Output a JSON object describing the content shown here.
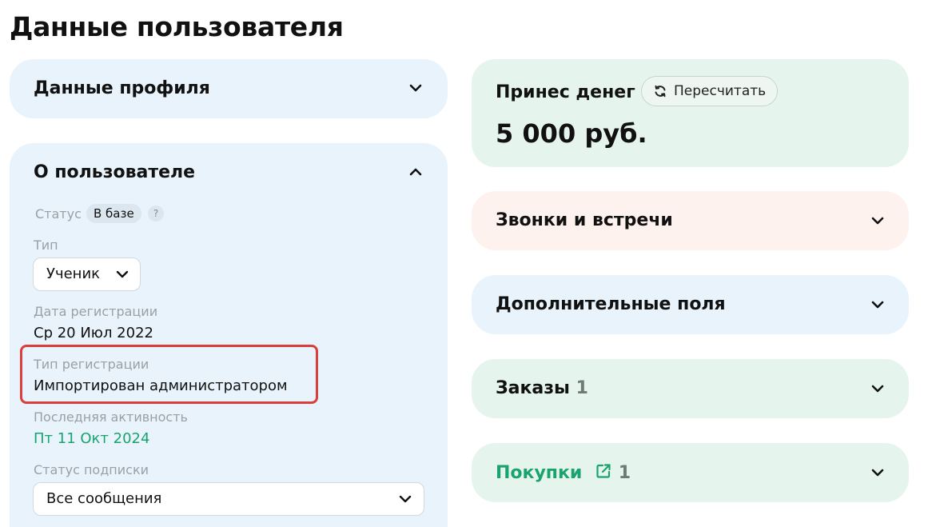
{
  "page": {
    "title": "Данные пользователя"
  },
  "profile_card": {
    "title": "Данные профиля",
    "chevron": "chevron-down-icon"
  },
  "about_card": {
    "title": "О пользователе",
    "chevron": "chevron-up-icon",
    "status": {
      "label": "Статус",
      "value": "В базе",
      "help": "?"
    },
    "type": {
      "label": "Тип",
      "value": "Ученик"
    },
    "registration_date": {
      "label": "Дата регистрации",
      "value": "Ср 20 Июл 2022"
    },
    "registration_type": {
      "label": "Тип регистрации",
      "value": "Импортирован администратором"
    },
    "last_activity": {
      "label": "Последняя активность",
      "value": "Пт 11 Окт 2024"
    },
    "subscription_status": {
      "label": "Статус подписки",
      "value": "Все сообщения"
    }
  },
  "money_card": {
    "title": "Принес денег",
    "recalc_label": "Пересчитать",
    "amount": "5 000 руб."
  },
  "calls_card": {
    "title": "Звонки и встречи"
  },
  "extra_fields_card": {
    "title": "Дополнительные поля"
  },
  "orders_card": {
    "title": "Заказы",
    "count": "1"
  },
  "purchases_card": {
    "title": "Покупки",
    "count": "1"
  },
  "colors": {
    "accent_green": "#1aa36f",
    "highlight_red": "#d9403c",
    "card_blue": "#e8f3fb",
    "card_green": "#e6f4ee",
    "card_peach": "#fdf2ee"
  }
}
